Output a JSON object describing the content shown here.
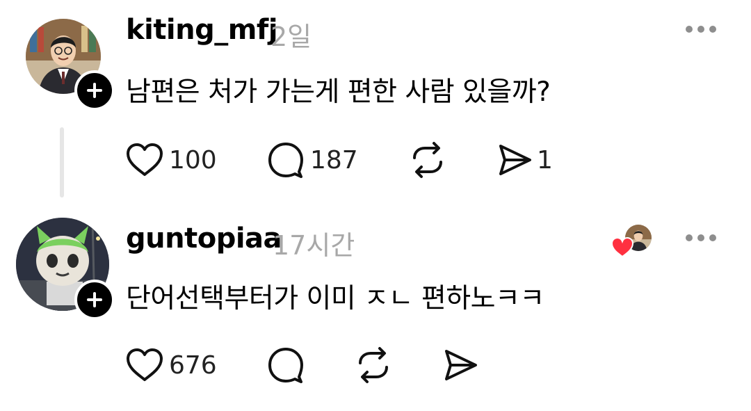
{
  "posts": [
    {
      "username": "kiting_mfj",
      "time": "2일",
      "text": "남편은 처가 가는게 편한 사람 있을까?",
      "likes": "100",
      "comments": "187",
      "shares": "1"
    },
    {
      "username": "guntopiaa",
      "time": "17시간",
      "text": "단어선택부터가 이미 ㅈㄴ 편하노ㅋㅋ",
      "likes": "676"
    }
  ],
  "colors": {
    "text": "#000000",
    "muted": "#a8a8a8",
    "icon": "#111111",
    "heart": "#ff3040",
    "divider": "#e6e6e6"
  },
  "icons": [
    "heart-icon",
    "comment-icon",
    "repost-icon",
    "share-icon",
    "more-icon",
    "plus-icon"
  ]
}
